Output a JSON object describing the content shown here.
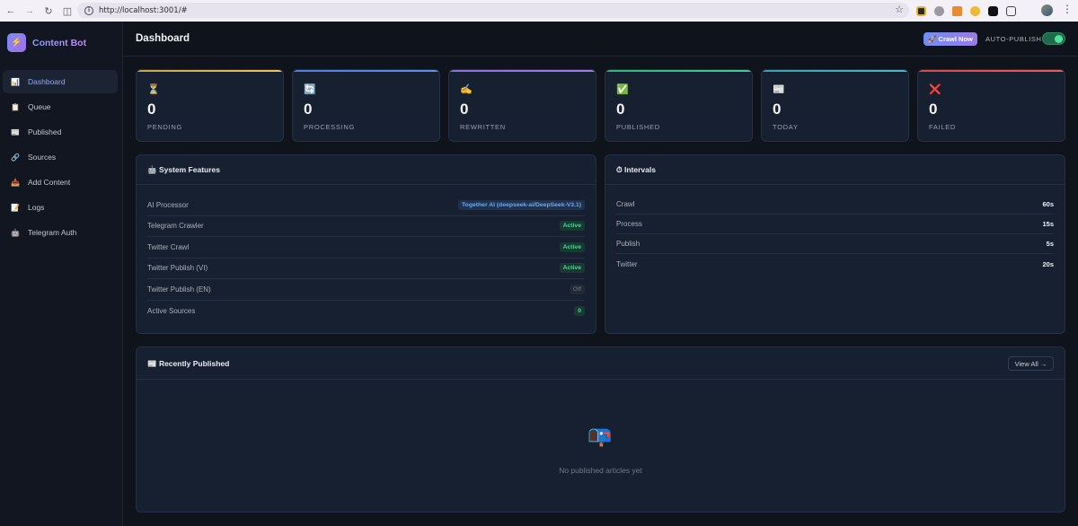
{
  "browser": {
    "url": "http://localhost:3001/#"
  },
  "brand": {
    "name": "Content Bot",
    "logo_icon": "⚡"
  },
  "sidebar": {
    "items": [
      {
        "label": "Dashboard",
        "icon": "📊"
      },
      {
        "label": "Queue",
        "icon": "📋"
      },
      {
        "label": "Published",
        "icon": "📰"
      },
      {
        "label": "Sources",
        "icon": "🔗"
      },
      {
        "label": "Add Content",
        "icon": "📥"
      },
      {
        "label": "Logs",
        "icon": "📝"
      },
      {
        "label": "Telegram Auth",
        "icon": "🤖"
      }
    ]
  },
  "header": {
    "title": "Dashboard",
    "crawl_label": "🚀 Crawl Now",
    "auto_publish_label": "AUTO-PUBLISH",
    "auto_publish_on": true
  },
  "stats": [
    {
      "icon": "⏳",
      "value": "0",
      "label": "PENDING",
      "color": "#f0c35a"
    },
    {
      "icon": "🔄",
      "value": "0",
      "label": "PROCESSING",
      "color": "#5f8ef5"
    },
    {
      "icon": "✍",
      "value": "0",
      "label": "REWRITTEN",
      "color": "#a07cf0"
    },
    {
      "icon": "✅",
      "value": "0",
      "label": "PUBLISHED",
      "color": "#3fcf8e"
    },
    {
      "icon": "📰",
      "value": "0",
      "label": "TODAY",
      "color": "#4fb3c9"
    },
    {
      "icon": "❌",
      "value": "0",
      "label": "FAILED",
      "color": "#ee5a5a"
    }
  ],
  "features": {
    "title": "🤖 System Features",
    "rows": [
      {
        "label": "AI Processor",
        "value": "Together AI (deepseek-ai/DeepSeek-V3.1)",
        "style": "blue"
      },
      {
        "label": "Telegram Crawler",
        "value": "Active",
        "style": "green"
      },
      {
        "label": "Twitter Crawl",
        "value": "Active",
        "style": "green"
      },
      {
        "label": "Twitter Publish (VI)",
        "value": "Active",
        "style": "green"
      },
      {
        "label": "Twitter Publish (EN)",
        "value": "Off",
        "style": "gray"
      },
      {
        "label": "Active Sources",
        "value": "0",
        "style": "green"
      }
    ]
  },
  "intervals": {
    "title": "⏱ Intervals",
    "rows": [
      {
        "label": "Crawl",
        "value": "60s"
      },
      {
        "label": "Process",
        "value": "15s"
      },
      {
        "label": "Publish",
        "value": "5s"
      },
      {
        "label": "Twitter",
        "value": "20s"
      }
    ]
  },
  "recent": {
    "title": "📰 Recently Published",
    "view_all": "View All →",
    "empty_icon": "📭",
    "empty_text": "No published articles yet"
  }
}
